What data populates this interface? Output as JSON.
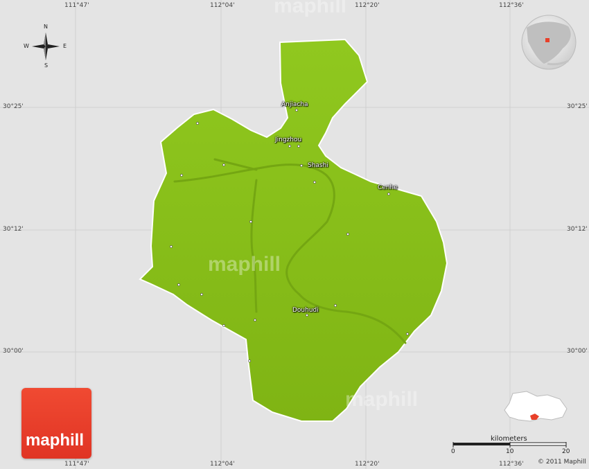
{
  "map": {
    "lon_labels": [
      "111°47'",
      "112°04'",
      "112°20'",
      "112°36'"
    ],
    "lat_labels": [
      "30°25'",
      "30°12'",
      "30°00'"
    ],
    "compass": {
      "n": "N",
      "s": "S",
      "e": "E",
      "w": "W"
    },
    "cities": [
      "Anjiacha",
      "Jingzhou",
      "Shashi",
      "Cenhe",
      "Douhudi"
    ],
    "scale": {
      "title": "kilometers",
      "ticks": [
        "0",
        "10",
        "20"
      ]
    },
    "copyright": "© 2011 Maphill",
    "logo_text": "maphill",
    "watermark": "maphill",
    "colors": {
      "land": "#88c21a",
      "background": "#e4e4e4",
      "highlight": "#e8402a"
    }
  }
}
